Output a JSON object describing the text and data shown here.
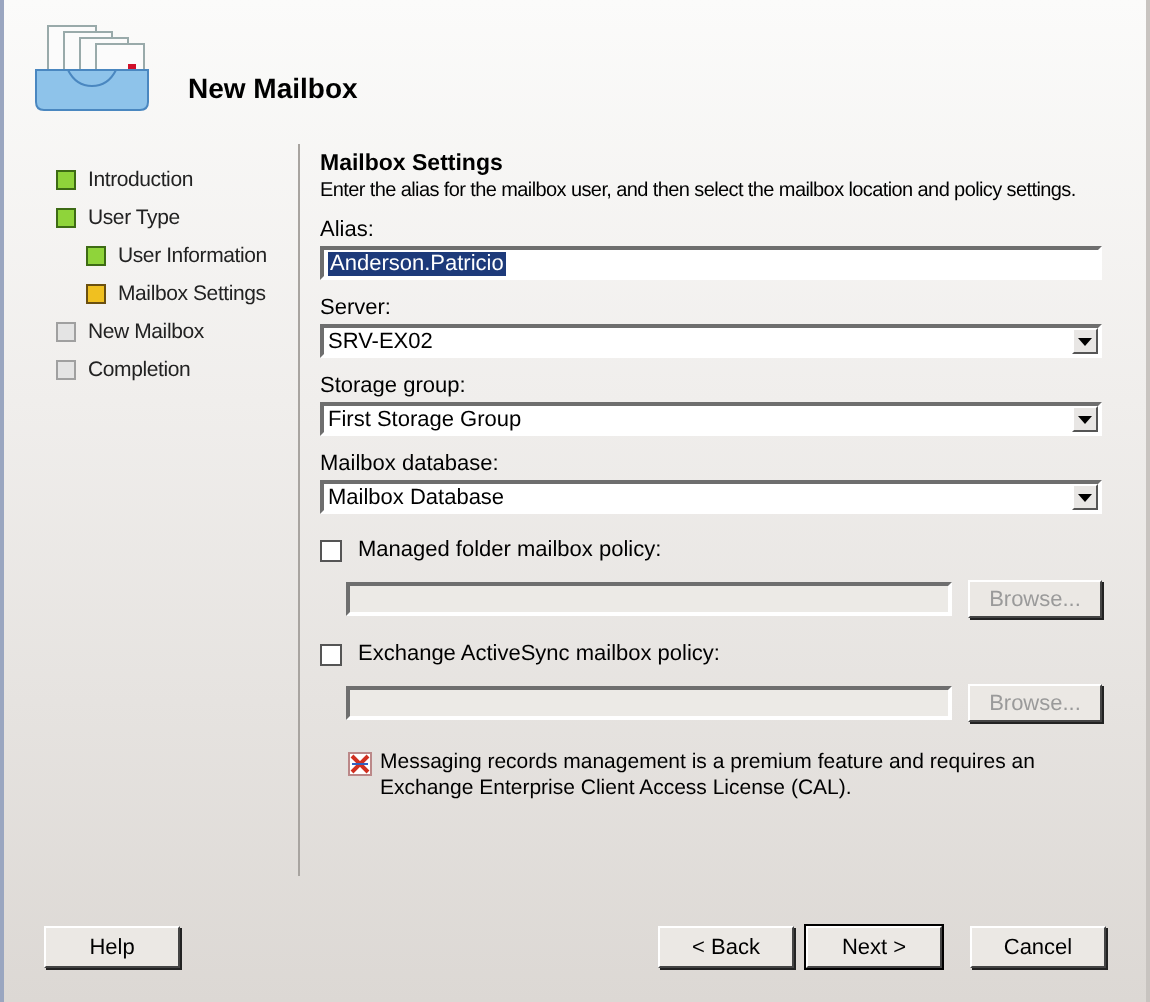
{
  "window": {
    "title": "New Mailbox"
  },
  "steps": [
    {
      "label": "Introduction",
      "kind": "done"
    },
    {
      "label": "User Type",
      "kind": "done",
      "children": [
        {
          "label": "User Information",
          "kind": "done"
        },
        {
          "label": "Mailbox Settings",
          "kind": "current"
        }
      ]
    },
    {
      "label": "New Mailbox",
      "kind": "pending"
    },
    {
      "label": "Completion",
      "kind": "pending"
    }
  ],
  "page": {
    "heading": "Mailbox Settings",
    "description": "Enter the alias for the mailbox user, and then select the mailbox location and policy settings."
  },
  "fields": [
    {
      "kind": "text",
      "label": "Alias:",
      "value": "Anderson.Patricio",
      "text_selected": true
    },
    {
      "kind": "combo",
      "label": "Server:",
      "value": "SRV-EX02"
    },
    {
      "kind": "combo",
      "label": "Storage group:",
      "value": "First Storage Group"
    },
    {
      "kind": "combo",
      "label": "Mailbox database:",
      "value": "Mailbox Database"
    }
  ],
  "policies": [
    {
      "label": "Managed folder mailbox policy:",
      "checked": false,
      "button": "Browse..."
    },
    {
      "label": "Exchange ActiveSync mailbox policy:",
      "checked": false,
      "button": "Browse..."
    }
  ],
  "note": "Messaging records management is a premium feature and requires an Exchange Enterprise Client Access License (CAL).",
  "buttons": {
    "help": "Help",
    "back": "< Back",
    "next": "Next >",
    "cancel": "Cancel"
  }
}
